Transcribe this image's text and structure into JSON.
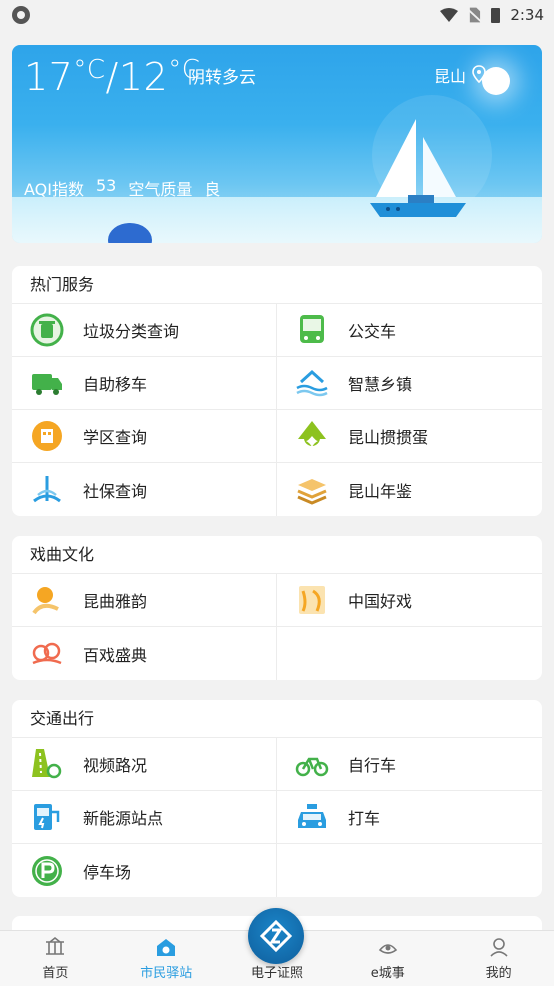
{
  "status_bar": {
    "time": "2:34"
  },
  "weather": {
    "temp_high": "17",
    "temp_low": "12",
    "unit": "°C",
    "separator": "/",
    "description": "阴转多云",
    "city": "昆山",
    "aqi_label": "AQI指数",
    "aqi_value": "53",
    "quality_label": "空气质量",
    "quality_value": "良"
  },
  "sections": {
    "hot": {
      "title": "热门服务",
      "items": [
        {
          "label": "垃圾分类查询",
          "icon": "recycle-icon"
        },
        {
          "label": "公交车",
          "icon": "bus-icon"
        },
        {
          "label": "自助移车",
          "icon": "truck-icon"
        },
        {
          "label": "智慧乡镇",
          "icon": "village-icon"
        },
        {
          "label": "学区查询",
          "icon": "school-icon"
        },
        {
          "label": "昆山掼掼蛋",
          "icon": "card-spade-icon"
        },
        {
          "label": "社保查询",
          "icon": "social-security-icon"
        },
        {
          "label": "昆山年鉴",
          "icon": "books-icon"
        }
      ]
    },
    "opera": {
      "title": "戏曲文化",
      "items": [
        {
          "label": "昆曲雅韵",
          "icon": "kunqu-icon"
        },
        {
          "label": "中国好戏",
          "icon": "opera-mask-icon"
        },
        {
          "label": "百戏盛典",
          "icon": "cloud-pattern-icon"
        }
      ]
    },
    "traffic": {
      "title": "交通出行",
      "items": [
        {
          "label": "视频路况",
          "icon": "road-camera-icon"
        },
        {
          "label": "自行车",
          "icon": "bicycle-icon"
        },
        {
          "label": "新能源站点",
          "icon": "charging-station-icon"
        },
        {
          "label": "打车",
          "icon": "taxi-icon"
        },
        {
          "label": "停车场",
          "icon": "parking-icon"
        }
      ]
    }
  },
  "tabs": [
    {
      "label": "首页",
      "icon": "home-pavilion-icon"
    },
    {
      "label": "市民驿站",
      "icon": "citizen-station-icon"
    },
    {
      "label": "电子证照",
      "icon": "e-license-icon"
    },
    {
      "label": "e城事",
      "icon": "city-affairs-icon"
    },
    {
      "label": "我的",
      "icon": "profile-icon"
    }
  ],
  "colors": {
    "accent": "#2a9de0",
    "weather_top": "#2ea4ea",
    "green": "#43b14a",
    "orange": "#f5a623"
  }
}
